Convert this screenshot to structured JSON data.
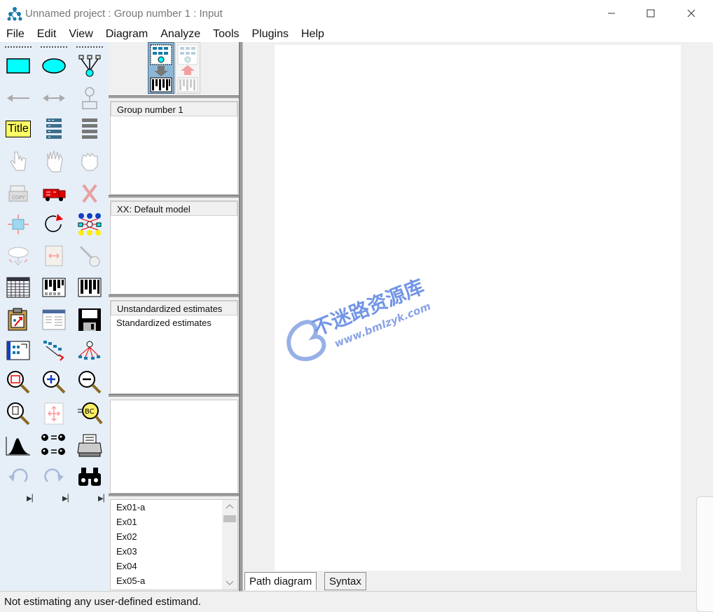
{
  "window": {
    "title": "Unnamed project : Group number 1 : Input",
    "controls": {
      "minimize": "minimize-icon",
      "maximize": "maximize-icon",
      "close": "close-icon"
    }
  },
  "menu": [
    "File",
    "Edit",
    "View",
    "Diagram",
    "Analyze",
    "Tools",
    "Plugins",
    "Help"
  ],
  "toolbox": {
    "tools": [
      "draw-observed-variable-icon",
      "draw-unobserved-variable-icon",
      "draw-indicator-icon",
      "draw-path-icon",
      "draw-covariance-icon",
      "draw-unique-variable-icon",
      "figure-caption-icon",
      "list-variables-in-model-icon",
      "list-variables-in-dataset-icon",
      "select-one-object-icon",
      "select-all-objects-icon",
      "deselect-all-objects-icon",
      "duplicate-objects-icon",
      "move-objects-icon",
      "erase-objects-icon",
      "change-shape-icon",
      "rotate-indicators-icon",
      "reflect-indicators-icon",
      "move-parameter-icon",
      "scroll-icon",
      "touch-up-icon",
      "select-data-files-icon",
      "analysis-properties-icon",
      "calculate-estimates-icon",
      "copy-diagram-icon",
      "view-text-icon",
      "save-diagram-icon",
      "object-properties-icon",
      "drag-properties-icon",
      "preserve-symmetries-icon",
      "zoom-selected-area-icon",
      "zoom-in-icon",
      "zoom-out-icon",
      "show-entire-page-icon",
      "resize-diagram-icon",
      "magnifier-icon",
      "bayesian-estimation-icon",
      "multiple-group-analysis-icon",
      "print-diagram-icon",
      "undo-icon",
      "redo-icon",
      "specification-search-icon"
    ],
    "title_tool_label": "Title"
  },
  "panels": {
    "groups": [
      "Group number 1"
    ],
    "models": [
      "XX: Default model"
    ],
    "estimates": [
      "Unstandardized estimates",
      "Standardized estimates"
    ],
    "files": [
      "Ex01-a",
      "Ex01",
      "Ex02",
      "Ex03",
      "Ex04",
      "Ex05-a"
    ]
  },
  "tabs": [
    "Path diagram",
    "Syntax"
  ],
  "status": "Not estimating any user-defined estimand.",
  "watermark": {
    "text_cn": "不迷路资源库",
    "text_url": "www.bmlzyk.com"
  },
  "colors": {
    "toolbox_bg": "#e6eef8",
    "rect_fill": "#00ffff",
    "title_fill": "#ffff66"
  }
}
